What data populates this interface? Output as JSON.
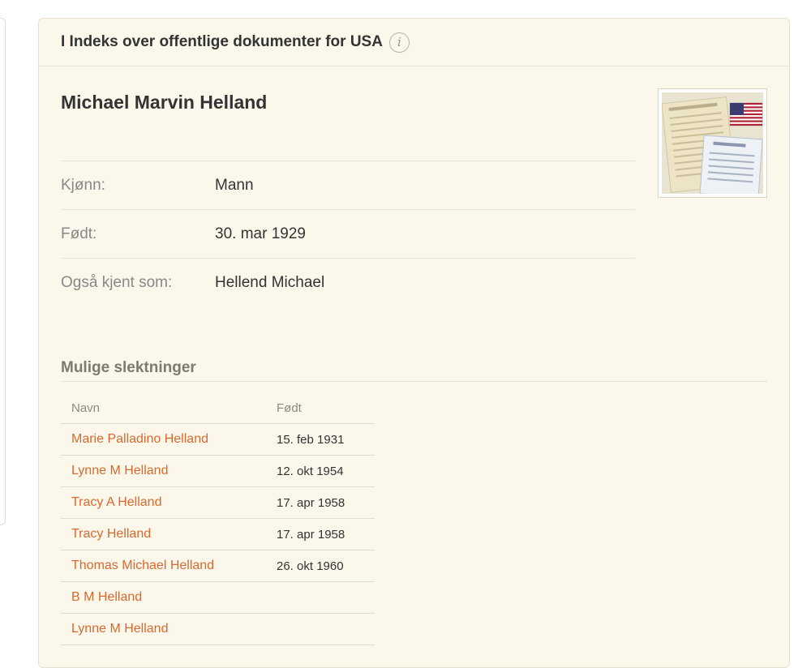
{
  "card": {
    "header_title": "I Indeks over offentlige dokumenter for USA",
    "info_icon_glyph": "i"
  },
  "person": {
    "name": "Michael Marvin Helland",
    "facts": [
      {
        "label": "Kjønn:",
        "value": "Mann"
      },
      {
        "label": "Født:",
        "value": "30. mar 1929"
      },
      {
        "label": "Også kjent som:",
        "value": "Hellend Michael"
      }
    ]
  },
  "thumbnail": {
    "icon": "us-flag-document-icon",
    "colors": {
      "flag_red": "#b22234",
      "flag_blue": "#3c3b6e"
    }
  },
  "relatives": {
    "title": "Mulige slektninger",
    "columns": {
      "name": "Navn",
      "born": "Født"
    },
    "rows": [
      {
        "name": "Marie Palladino Helland",
        "born": "15. feb 1931"
      },
      {
        "name": "Lynne M Helland",
        "born": "12. okt 1954"
      },
      {
        "name": "Tracy A Helland",
        "born": "17. apr 1958"
      },
      {
        "name": "Tracy Helland",
        "born": "17. apr 1958"
      },
      {
        "name": "Thomas Michael Helland",
        "born": "26. okt 1960"
      },
      {
        "name": "B M Helland",
        "born": ""
      },
      {
        "name": "Lynne M Helland",
        "born": ""
      }
    ]
  },
  "colors": {
    "card_bg": "#fbf7ea",
    "link": "#d9692e",
    "text": "#333333",
    "muted": "#888888"
  }
}
